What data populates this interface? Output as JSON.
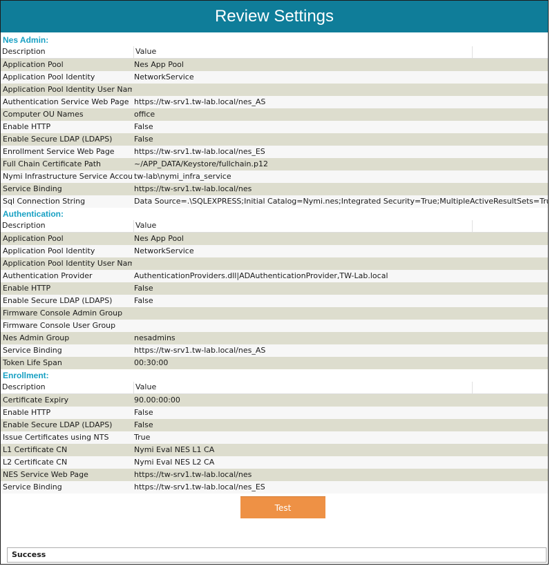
{
  "window": {
    "title": "Review Settings"
  },
  "sections": [
    {
      "title": "Nes Admin:",
      "headers": [
        "Description",
        "Value"
      ],
      "rows": [
        [
          "Application Pool",
          "Nes App Pool"
        ],
        [
          "Application Pool Identity",
          "NetworkService"
        ],
        [
          "Application Pool Identity User Name",
          ""
        ],
        [
          "Authentication Service Web Page",
          "https://tw-srv1.tw-lab.local/nes_AS"
        ],
        [
          "Computer OU Names",
          "office"
        ],
        [
          "Enable HTTP",
          "False"
        ],
        [
          "Enable Secure LDAP (LDAPS)",
          "False"
        ],
        [
          "Enrollment Service Web Page",
          "https://tw-srv1.tw-lab.local/nes_ES"
        ],
        [
          "Full Chain Certificate Path",
          "~/APP_DATA/Keystore/fullchain.p12"
        ],
        [
          "Nymi Infrastructure Service Account",
          "tw-lab\\nymi_infra_service"
        ],
        [
          "Service Binding",
          "https://tw-srv1.tw-lab.local/nes"
        ],
        [
          "Sql Connection String",
          "Data Source=.\\SQLEXPRESS;Initial Catalog=Nymi.nes;Integrated Security=True;MultipleActiveResultSets=True"
        ]
      ]
    },
    {
      "title": "Authentication:",
      "headers": [
        "Description",
        "Value"
      ],
      "rows": [
        [
          "Application Pool",
          "Nes App Pool"
        ],
        [
          "Application Pool Identity",
          "NetworkService"
        ],
        [
          "Application Pool Identity User Name",
          ""
        ],
        [
          "Authentication Provider",
          "AuthenticationProviders.dll|ADAuthenticationProvider,TW-Lab.local"
        ],
        [
          "Enable HTTP",
          "False"
        ],
        [
          "Enable Secure LDAP (LDAPS)",
          "False"
        ],
        [
          "Firmware Console Admin Group",
          ""
        ],
        [
          "Firmware Console User Group",
          ""
        ],
        [
          "Nes Admin Group",
          "nesadmins"
        ],
        [
          "Service Binding",
          "https://tw-srv1.tw-lab.local/nes_AS"
        ],
        [
          "Token Life Span",
          "00:30:00"
        ]
      ]
    },
    {
      "title": "Enrollment:",
      "headers": [
        "Description",
        "Value"
      ],
      "rows": [
        [
          "Certificate Expiry",
          "90.00:00:00"
        ],
        [
          "Enable HTTP",
          "False"
        ],
        [
          "Enable Secure LDAP (LDAPS)",
          "False"
        ],
        [
          "Issue Certificates using NTS",
          "True"
        ],
        [
          "L1 Certificate CN",
          "Nymi Eval NES L1 CA"
        ],
        [
          "L2 Certificate CN",
          "Nymi Eval NES L2 CA"
        ],
        [
          "NES Service Web Page",
          "https://tw-srv1.tw-lab.local/nes"
        ],
        [
          "Service Binding",
          "https://tw-srv1.tw-lab.local/nes_ES"
        ]
      ]
    }
  ],
  "actions": {
    "test_label": "Test"
  },
  "status": {
    "text": "Success"
  },
  "colors": {
    "title_bar": "#0f7d99",
    "section_title": "#17a0c3",
    "test_button": "#ee9145",
    "row_alt": "#ddddce"
  }
}
